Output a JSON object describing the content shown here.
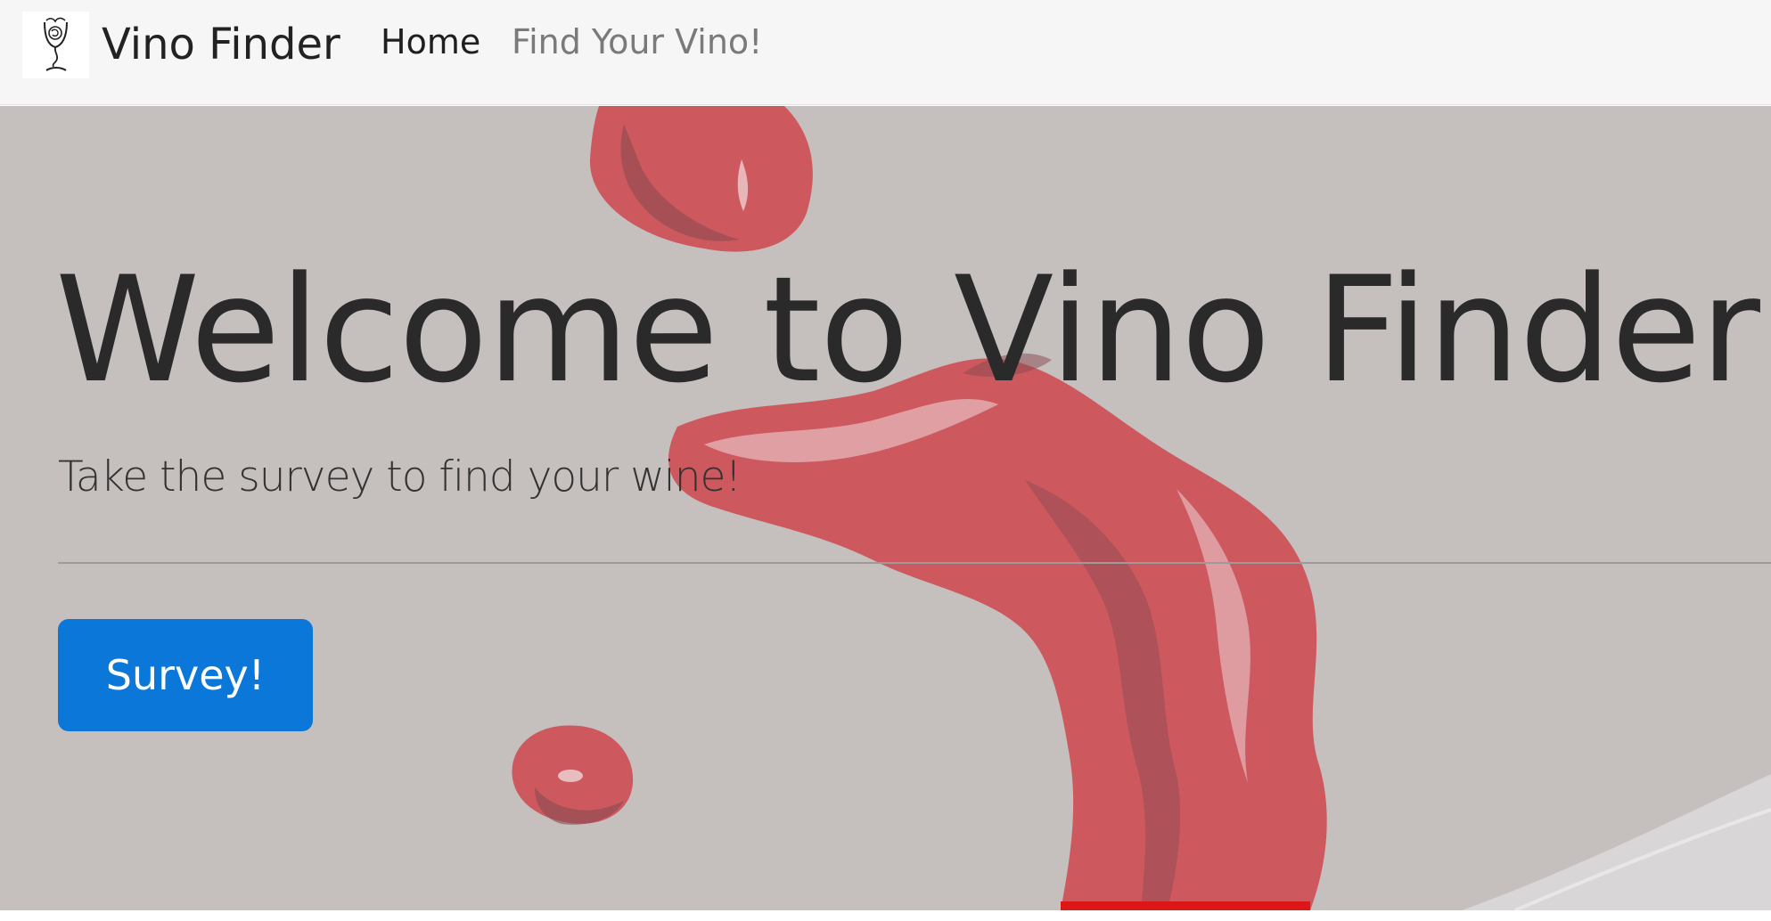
{
  "navbar": {
    "brand_name": "Vino Finder",
    "links": [
      {
        "label": "Home",
        "active": true
      },
      {
        "label": "Find Your Vino!",
        "active": false
      }
    ]
  },
  "hero": {
    "title": "Welcome to Vino Finder!",
    "subtitle": "Take the survey to find your wine!",
    "button_label": "Survey!",
    "background_color": "#c5c0bf",
    "wine_color": "#cf4c52"
  },
  "colors": {
    "navbar_bg": "#f6f6f6",
    "button_bg": "#0b78d9",
    "text": "#2a2a2a",
    "muted_link": "#7a7a7a"
  }
}
